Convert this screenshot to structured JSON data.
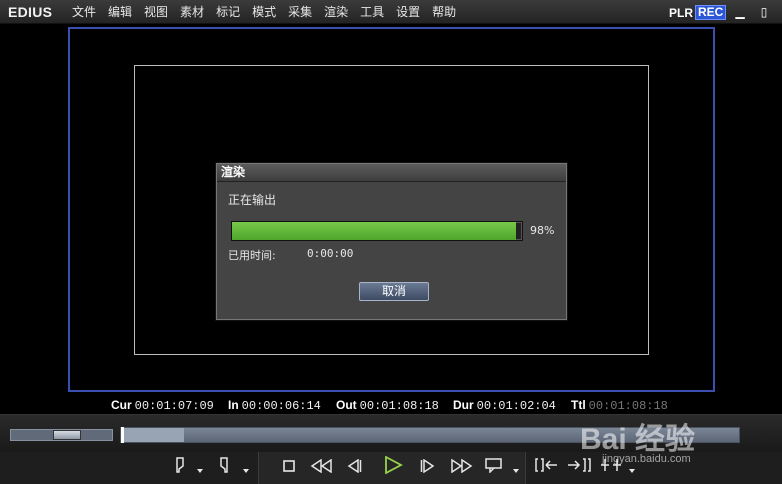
{
  "app": {
    "logo": "EDIUS"
  },
  "menu": {
    "items": [
      "文件",
      "编辑",
      "视图",
      "素材",
      "标记",
      "模式",
      "采集",
      "渲染",
      "工具",
      "设置",
      "帮助"
    ]
  },
  "mode": {
    "plr": "PLR",
    "rec": "REC"
  },
  "window_controls": {
    "minimize": "▁",
    "maximize": "▯"
  },
  "dialog": {
    "title": "渲染",
    "status": "正在输出",
    "progress": 98,
    "progress_label": "98%",
    "elapsed_label": "已用时间:",
    "elapsed_value": "0:00:00",
    "cancel_label": "取消"
  },
  "timecodes": {
    "cur": {
      "label": "Cur",
      "value": "00:01:07:09"
    },
    "in": {
      "label": "In",
      "value": "00:00:06:14"
    },
    "out": {
      "label": "Out",
      "value": "00:01:08:18"
    },
    "dur": {
      "label": "Dur",
      "value": "00:01:02:04"
    },
    "ttl": {
      "label": "Ttl",
      "value": "00:01:08:18"
    }
  },
  "watermark": {
    "brand": "Bai 经验",
    "url": "jingyan.baidu.com"
  },
  "colors": {
    "accent_blue": "#3a4fb0",
    "progress_green": "#5cb534",
    "play_green": "#9bd14a"
  },
  "icons": {
    "set_in": "set-in-icon",
    "set_out": "set-out-icon",
    "stop": "stop-icon",
    "rewind": "rewind-icon",
    "step_back": "step-back-icon",
    "play": "play-icon",
    "step_forward": "step-forward-icon",
    "fast_forward": "fast-forward-icon",
    "loop": "loop-icon"
  }
}
